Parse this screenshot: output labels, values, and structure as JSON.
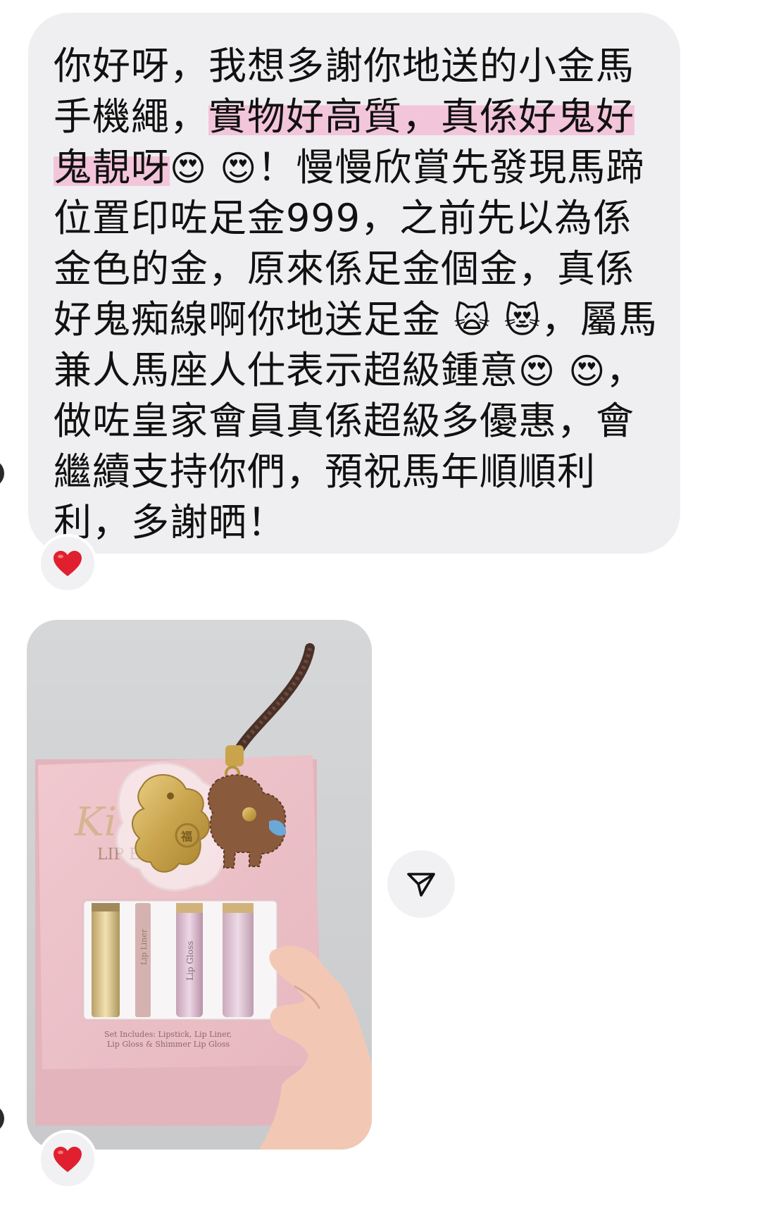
{
  "message": {
    "text_before_highlight": "你好呀，我想多謝你地送的小金馬手機繩，",
    "highlight": "實物好高質，真係好鬼好鬼靚呀",
    "emoji_1": "😍",
    "emoji_2": "😍",
    "text_after_1": "！慢慢欣賞先發現馬蹄位置印咗足金999，之前先以為係金色的金，原來係足金個金，真係好鬼痴線啊你地送足金",
    "emoji_3": "🙀",
    "emoji_4": "😻",
    "text_after_2": "，屬馬兼人馬座人仕表示超級鍾意",
    "emoji_5": "😍",
    "emoji_6": "😍",
    "text_after_3": "，做咗皇家會員真係超級多優惠，會繼續支持你們，預祝馬年順順利利，多謝晒！"
  },
  "reactions": {
    "message_reaction": "❤️",
    "photo_reaction": "❤️"
  },
  "photo": {
    "box_script_label": "Ki",
    "box_label": "LIP ESS",
    "lip_liner_label": "Lip Liner",
    "lip_gloss_label": "Lip Gloss",
    "set_includes_line1": "Set Includes: Lipstick, Lip Liner,",
    "set_includes_line2": "Lip Gloss & Shimmer Lip Gloss",
    "charm_character": "福"
  },
  "icons": {
    "share": "send-icon",
    "heart": "heart-icon"
  },
  "colors": {
    "bubble": "#efeff1",
    "highlight": "#f4bed6",
    "box_pink": "#ecc2c8",
    "gold": "#c9a44d"
  }
}
